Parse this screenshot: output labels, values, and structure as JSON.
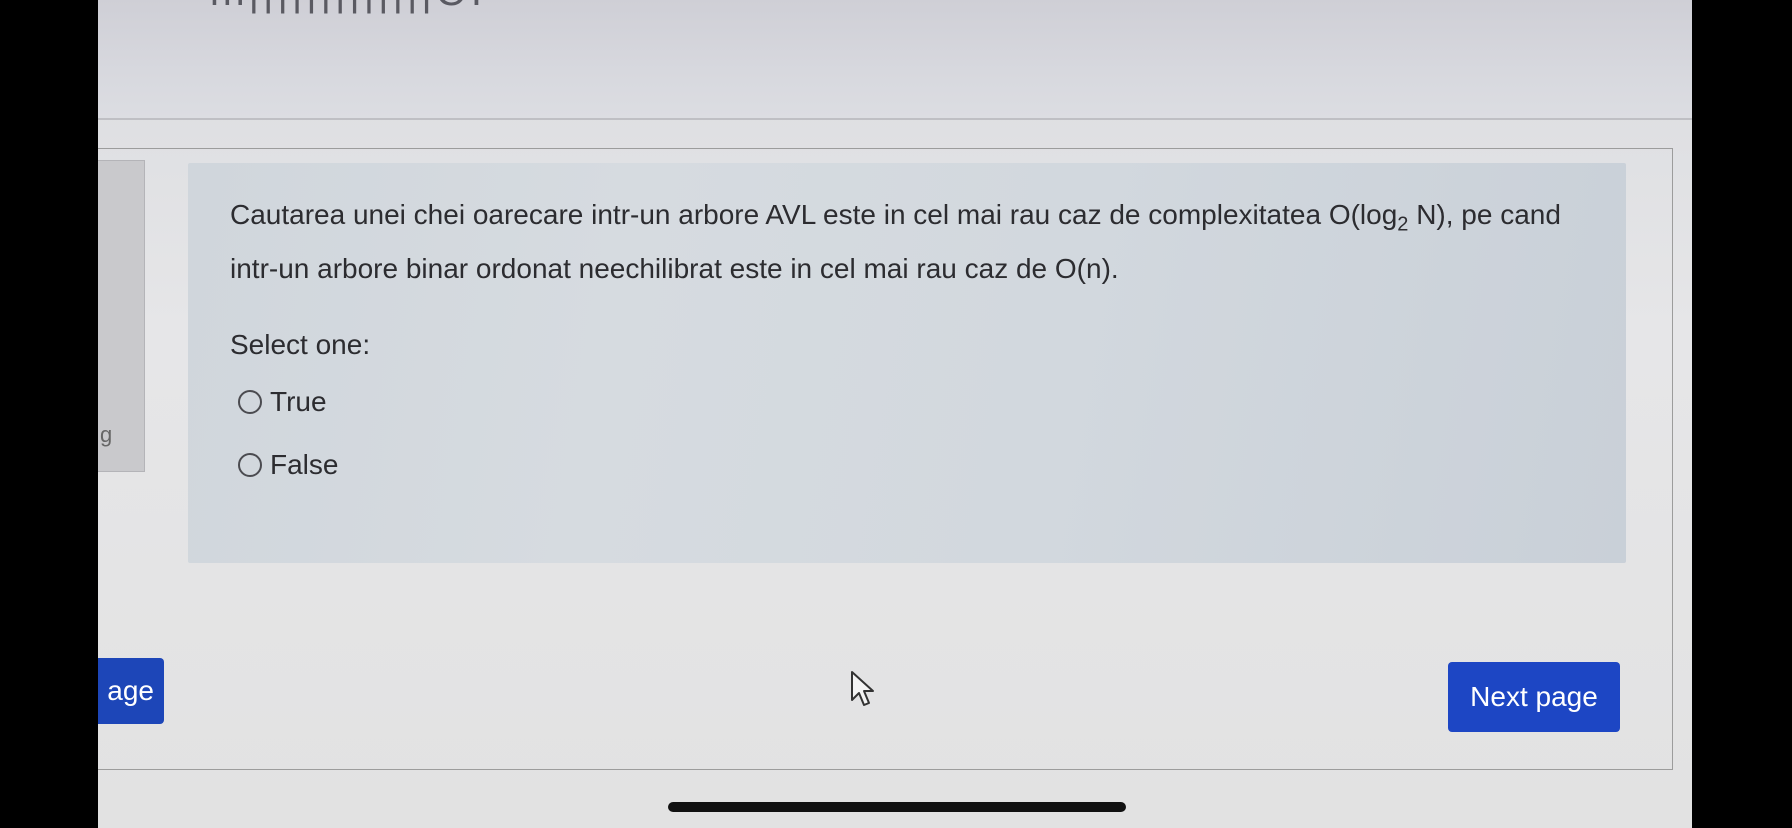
{
  "heading_fragment": "lll|||||||||||||OI",
  "info_panel_letter": "g",
  "question": {
    "text_before_subscript": "Cautarea unei chei oarecare intr-un arbore AVL este in cel mai rau caz de complexitatea O(log",
    "subscript": "2",
    "text_after_subscript": " N), pe cand intr-un arbore binar ordonat neechilibrat este in cel mai rau caz de O(n).",
    "select_label": "Select one:",
    "options": [
      {
        "label": "True"
      },
      {
        "label": "False"
      }
    ]
  },
  "navigation": {
    "prev_label_fragment": "age",
    "next_label": "Next page"
  },
  "colors": {
    "button_blue": "#1d46c4",
    "question_box": "#d3d9df"
  },
  "icons": [
    "mouse-cursor-icon",
    "radio-unchecked-icon"
  ]
}
